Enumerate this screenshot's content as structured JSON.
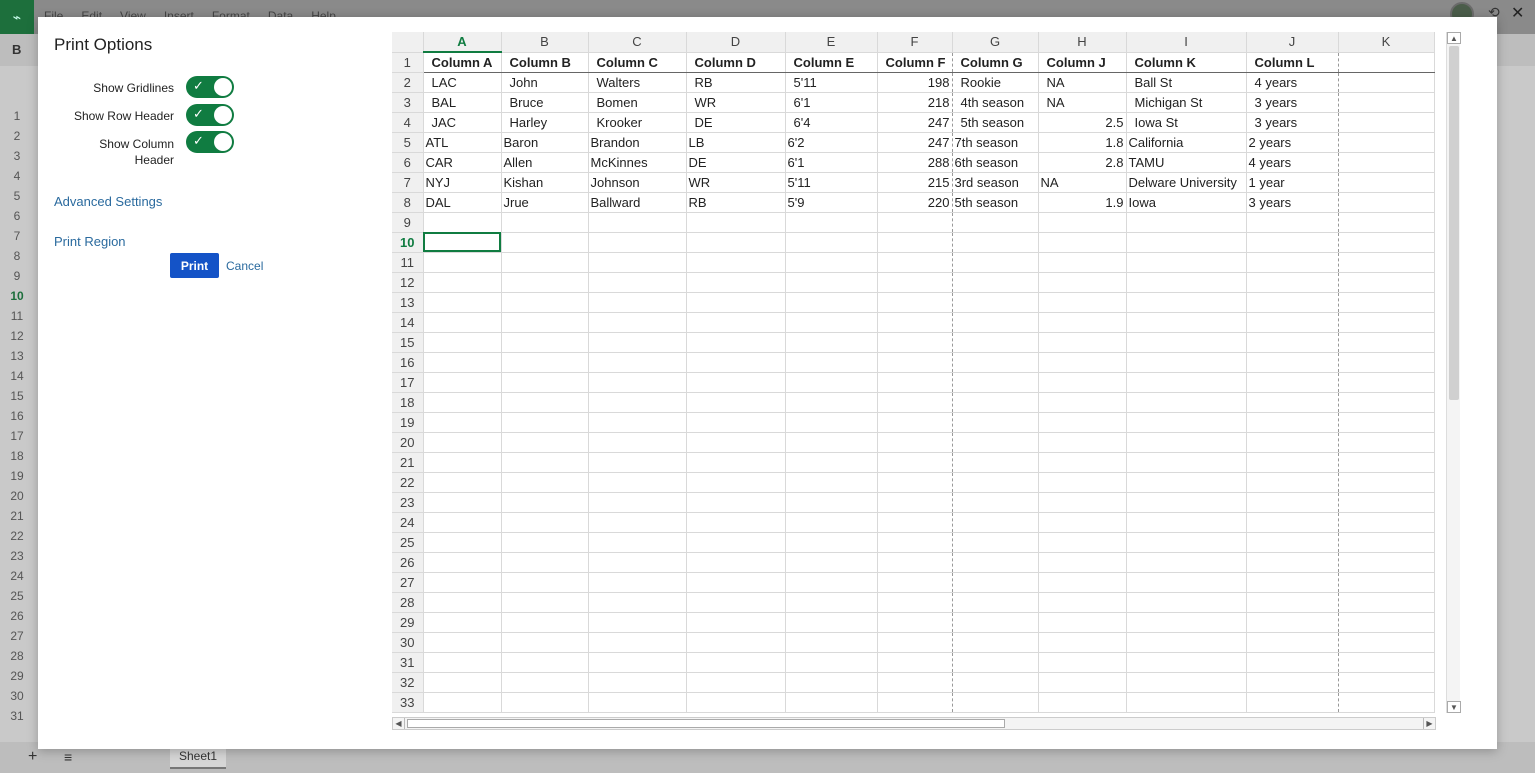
{
  "background": {
    "menus": [
      "File",
      "Edit",
      "View",
      "Insert",
      "Format",
      "Data",
      "Help"
    ],
    "toolbar_bold": "B",
    "row_numbers": [
      "1",
      "2",
      "3",
      "4",
      "5",
      "6",
      "7",
      "8",
      "9",
      "10",
      "11",
      "12",
      "13",
      "14",
      "15",
      "16",
      "17",
      "18",
      "19",
      "20",
      "21",
      "22",
      "23",
      "24",
      "25",
      "26",
      "27",
      "28",
      "29",
      "30",
      "31"
    ],
    "active_row": "10",
    "sheet_tab": "Sheet1",
    "add_sheet_icon": "plus-icon",
    "sheets_menu_icon": "menu-icon"
  },
  "modal": {
    "title": "Print Options",
    "options": [
      {
        "label": "Show Gridlines",
        "on": true
      },
      {
        "label": "Show Row Header",
        "on": true
      },
      {
        "label": "Show Column Header",
        "on": true
      }
    ],
    "advanced_settings": "Advanced Settings",
    "print_region": "Print Region",
    "print_button": "Print",
    "cancel_button": "Cancel"
  },
  "preview": {
    "columns": [
      "A",
      "B",
      "C",
      "D",
      "E",
      "F",
      "G",
      "H",
      "I",
      "J",
      "K"
    ],
    "active_column": "A",
    "active_row": "10",
    "header_row": [
      "Column A",
      "Column B",
      "Column C",
      "Column D",
      "Column E",
      "Column F",
      "Column G",
      "Column J",
      "Column K",
      "Column L",
      ""
    ],
    "rows": [
      [
        "LAC",
        "John",
        "Walters",
        "RB",
        "5'11",
        "198",
        "Rookie",
        "NA",
        "Ball St",
        "4 years",
        ""
      ],
      [
        "BAL",
        "Bruce",
        "Bomen",
        "WR",
        "6'1",
        "218",
        "4th season",
        "NA",
        "Michigan St",
        "3 years",
        ""
      ],
      [
        "JAC",
        "Harley",
        "Krooker",
        "DE",
        "6'4",
        "247",
        "5th season",
        "2.5",
        "Iowa St",
        "3 years",
        ""
      ],
      [
        "ATL",
        "Baron",
        "Brandon",
        "LB",
        "6'2",
        "247",
        "7th season",
        "1.8",
        "California",
        "2 years",
        ""
      ],
      [
        "CAR",
        "Allen",
        "McKinnes",
        "DE",
        "6'1",
        "288",
        "6th season",
        "2.8",
        "TAMU",
        "4 years",
        ""
      ],
      [
        "NYJ",
        "Kishan",
        "Johnson",
        "WR",
        "5'11",
        "215",
        "3rd season",
        "NA",
        "Delware University",
        "1 year",
        ""
      ],
      [
        "DAL",
        "Jrue",
        "Ballward",
        "RB",
        "5'9",
        "220",
        "5th season",
        "1.9",
        "Iowa",
        "3 years",
        ""
      ]
    ],
    "row_numbers": [
      "1",
      "2",
      "3",
      "4",
      "5",
      "6",
      "7",
      "8",
      "9",
      "10",
      "11",
      "12",
      "13",
      "14",
      "15",
      "16",
      "17",
      "18",
      "19",
      "20",
      "21",
      "22",
      "23",
      "24",
      "25",
      "26",
      "27",
      "28",
      "29",
      "30",
      "31",
      "32",
      "33"
    ]
  }
}
